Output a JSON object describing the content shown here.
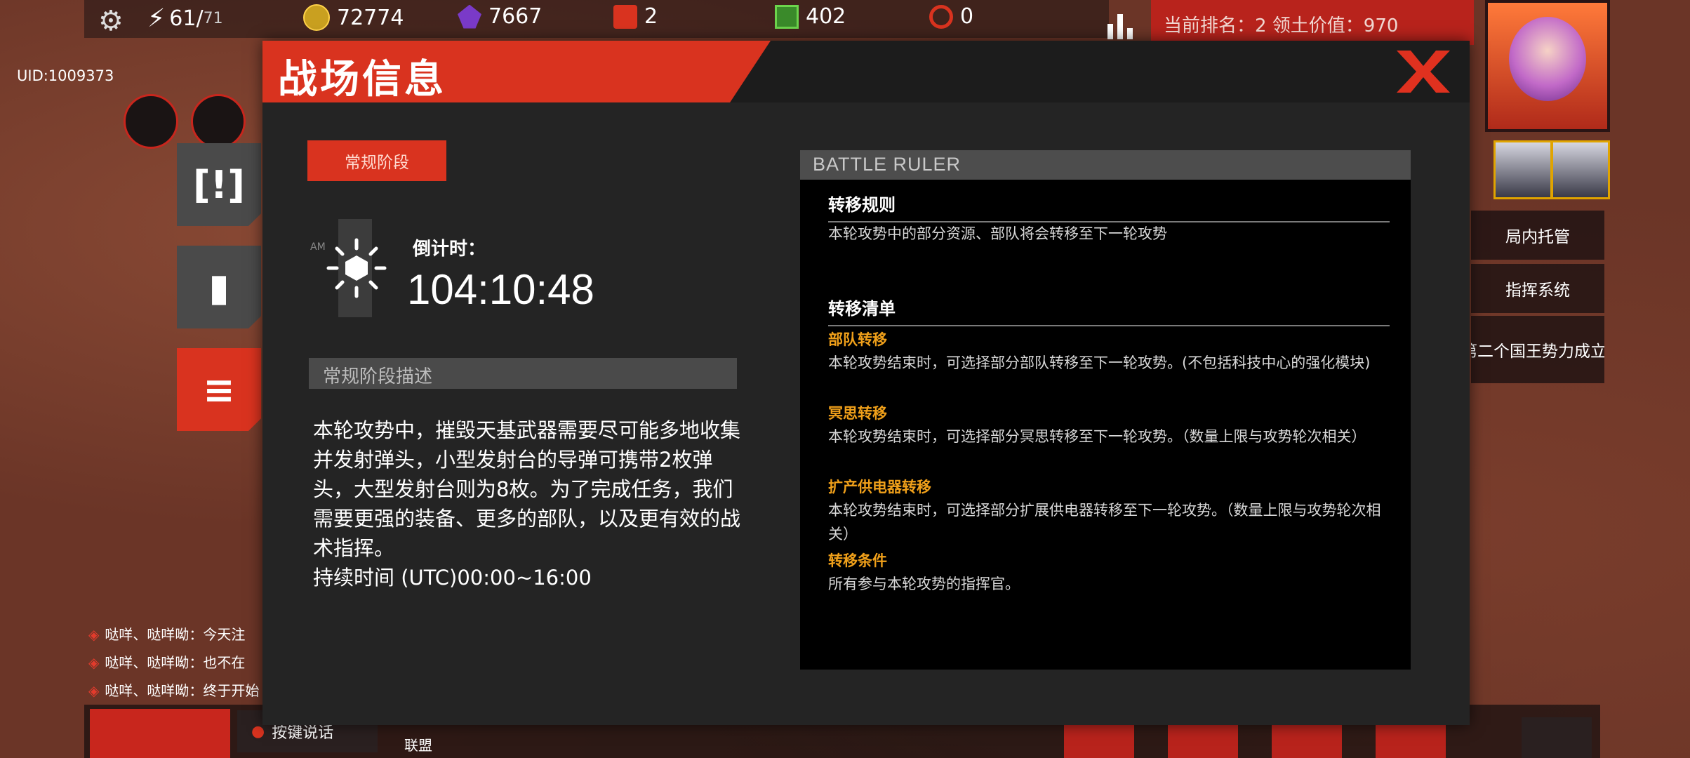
{
  "hud": {
    "energy": "61",
    "energy_max": "71",
    "gold": "72774",
    "crystal": "7667",
    "fuel": "2",
    "chip": "402",
    "points": "0",
    "uid": "UID:1009373",
    "rank_text": "当前排名：2  领土价值：970"
  },
  "right_menu": {
    "auto_manage": "局内托管",
    "command_system": "指挥系统",
    "event_text": "第二个国王势力成立"
  },
  "chat": {
    "lines": [
      "哒咩、哒咩呦：今天注",
      "哒咩、哒咩呦：也不在",
      "哒咩、哒咩呦：终于开始"
    ],
    "voice_label": "按键说话",
    "alliance_label": "联盟"
  },
  "modal": {
    "title": "战场信息",
    "phase_tag": "常规阶段",
    "am_label": "AM",
    "countdown_label": "倒计时：",
    "countdown_value": "104:10:48",
    "desc_header": "常规阶段描述",
    "desc_text": "本轮攻势中，摧毁天基武器需要尽可能多地收集并发射弹头，小型发射台的导弹可携带2枚弹头，大型发射台则为8枚。为了完成任务，我们需要更强的装备、更多的部队，以及更有效的战术指挥。",
    "duration": "持续时间 (UTC)00:00~16:00",
    "battle_ruler": {
      "header": "BATTLE RULER",
      "rule_title": "转移规则",
      "rule_text": "本轮攻势中的部分资源、部队将会转移至下一轮攻势",
      "list_title": "转移清单",
      "items": [
        {
          "name": "部队转移",
          "text": "本轮攻势结束时，可选择部分部队转移至下一轮攻势。(不包括科技中心的强化模块)"
        },
        {
          "name": "冥思转移",
          "text": "本轮攻势结束时，可选择部分冥思转移至下一轮攻势。（数量上限与攻势轮次相关）"
        },
        {
          "name": "扩产供电器转移",
          "text": "本轮攻势结束时，可选择部分扩展供电器转移至下一轮攻势。（数量上限与攻势轮次相关）"
        },
        {
          "name": "转移条件",
          "text": "所有参与本轮攻势的指挥官。"
        }
      ]
    }
  },
  "colors": {
    "accent": "#d9331f",
    "highlight": "#f0a01a"
  }
}
